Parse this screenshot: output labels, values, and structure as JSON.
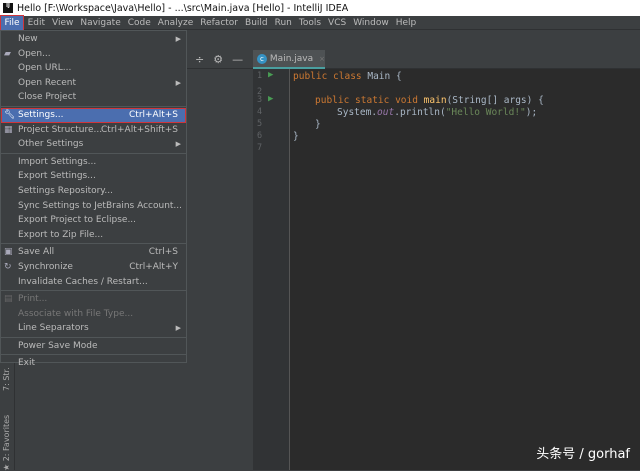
{
  "window": {
    "title": "Hello [F:\\Workspace\\Java\\Hello] - ...\\src\\Main.java [Hello] - IntelliJ IDEA",
    "logo": "IJ"
  },
  "menubar": [
    "File",
    "Edit",
    "View",
    "Navigate",
    "Code",
    "Analyze",
    "Refactor",
    "Build",
    "Run",
    "Tools",
    "VCS",
    "Window",
    "Help"
  ],
  "file_menu": {
    "new": "New",
    "open": "Open...",
    "open_url": "Open URL...",
    "open_recent": "Open Recent",
    "close_project": "Close Project",
    "settings": "Settings...",
    "settings_sc": "Ctrl+Alt+S",
    "project_structure": "Project Structure...",
    "project_structure_sc": "Ctrl+Alt+Shift+S",
    "other_settings": "Other Settings",
    "import_settings": "Import Settings...",
    "export_settings": "Export Settings...",
    "settings_repo": "Settings Repository...",
    "sync_settings": "Sync Settings to JetBrains Account...",
    "export_eclipse": "Export Project to Eclipse...",
    "export_zip": "Export to Zip File...",
    "save_all": "Save All",
    "save_all_sc": "Ctrl+S",
    "synchronize": "Synchronize",
    "synchronize_sc": "Ctrl+Alt+Y",
    "invalidate": "Invalidate Caches / Restart...",
    "print": "Print...",
    "associate": "Associate with File Type...",
    "line_separators": "Line Separators",
    "power_save": "Power Save Mode",
    "exit": "Exit"
  },
  "side": {
    "structure": "7: Str.",
    "favorites": "2: Favorites"
  },
  "editor": {
    "tab": "Main.java",
    "line_numbers": [
      "1",
      "2",
      "3",
      "4",
      "5",
      "6",
      "7"
    ],
    "code": {
      "l1_kw": "public class ",
      "l1_name": "Main {",
      "l3_kw": "public static void ",
      "l3_fn": "main",
      "l3_rest": "(String[] args) {",
      "l4_a": "System.",
      "l4_out": "out",
      "l4_b": ".println(",
      "l4_str": "\"Hello World!\"",
      "l4_c": ");",
      "l5": "}",
      "l6": "}"
    }
  },
  "watermark": "头条号 / gorhaf"
}
